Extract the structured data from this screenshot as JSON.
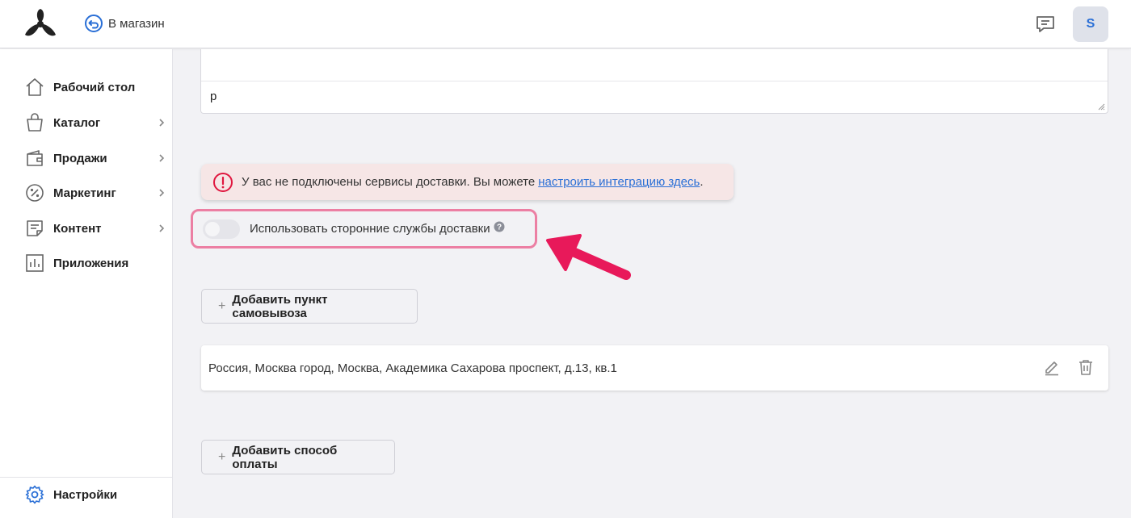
{
  "header": {
    "store_link_label": "В магазин",
    "avatar_letter": "S"
  },
  "sidebar": {
    "items": [
      {
        "label": "Рабочий стол",
        "icon": "home-icon",
        "has_submenu": false
      },
      {
        "label": "Каталог",
        "icon": "shopping-bag-icon",
        "has_submenu": true
      },
      {
        "label": "Продажи",
        "icon": "wallet-icon",
        "has_submenu": true
      },
      {
        "label": "Маркетинг",
        "icon": "percent-icon",
        "has_submenu": true
      },
      {
        "label": "Контент",
        "icon": "document-icon",
        "has_submenu": true
      },
      {
        "label": "Приложения",
        "icon": "bar-chart-icon",
        "has_submenu": false
      }
    ],
    "settings_label": "Настройки"
  },
  "form": {
    "textarea_value": "р",
    "alert_text": "У вас не подключены сервисы доставки. Вы можете",
    "alert_link": "настроить интеграцию здесь",
    "alert_suffix": ".",
    "toggle_label": "Использовать сторонние службы доставки",
    "toggle_on": false,
    "add_pickup_label": "Добавить пункт самовывоза",
    "pickup_address": "Россия, Москва город, Москва, Академика Сахарова проспект, д.13, кв.1",
    "add_payment_label": "Добавить способ оплаты"
  },
  "colors": {
    "accent": "#2a6fd6",
    "highlight_border": "#ec7fa3",
    "arrow": "#e8195a",
    "alert_bg": "#f6e6e6",
    "warn_icon": "#e0173f"
  }
}
